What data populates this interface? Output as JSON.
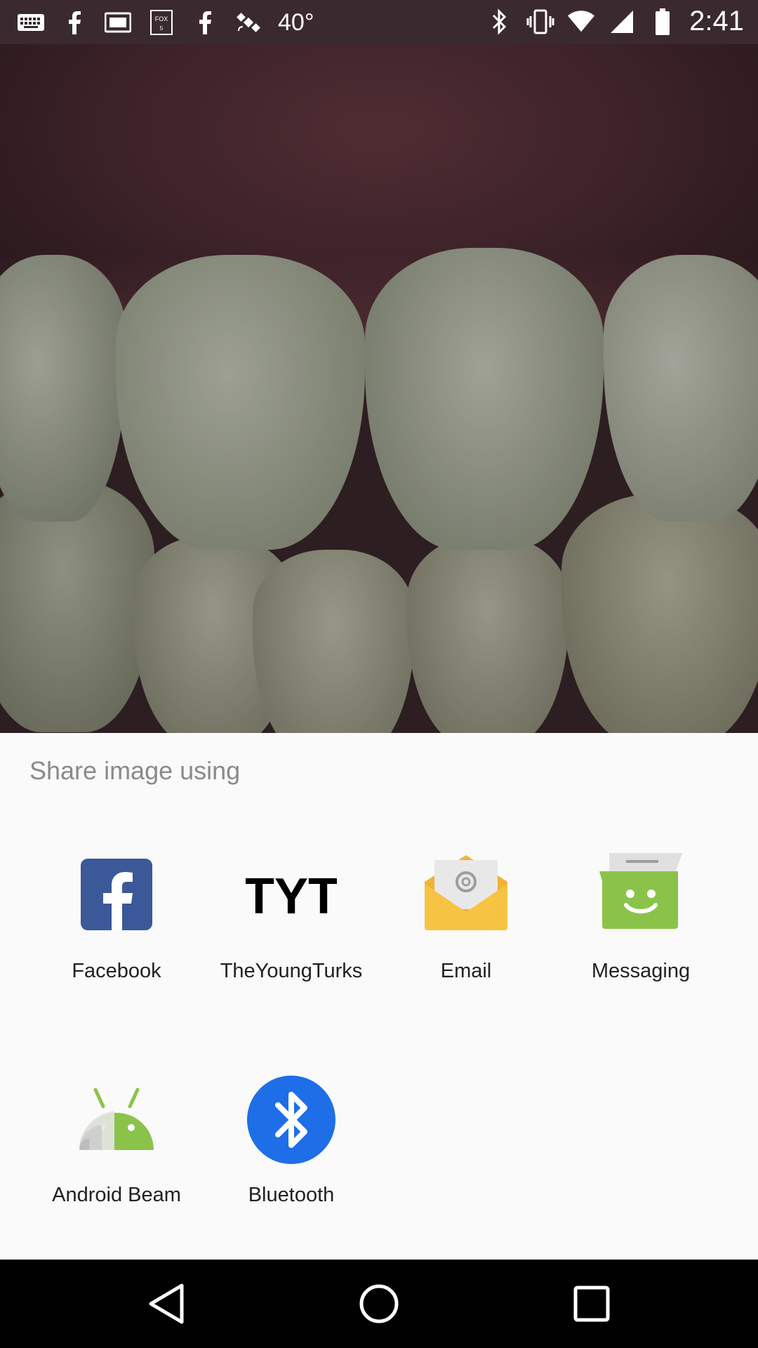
{
  "status_bar": {
    "temperature": "40°",
    "time": "2:41"
  },
  "share_sheet": {
    "title": "Share image using",
    "apps": [
      {
        "label": "Facebook",
        "icon": "facebook-icon",
        "color": "#3b5998"
      },
      {
        "label": "TheYoungTurks",
        "icon": "tyt-icon",
        "color": "#000000"
      },
      {
        "label": "Email",
        "icon": "email-icon",
        "color": "#f6c342"
      },
      {
        "label": "Messaging",
        "icon": "messaging-icon",
        "color": "#8bc34a"
      },
      {
        "label": "Android Beam",
        "icon": "android-beam-icon",
        "color": "#8bc34a"
      },
      {
        "label": "Bluetooth",
        "icon": "bluetooth-icon",
        "color": "#1e6ee8"
      }
    ],
    "tyt_logo_text": "TYT"
  },
  "nav_bar": {
    "back": "back-icon",
    "home": "home-icon",
    "recents": "recents-icon"
  }
}
